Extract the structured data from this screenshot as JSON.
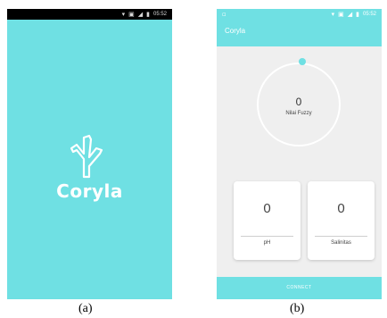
{
  "screen_a": {
    "status_time": "05:52",
    "brand": "Coryla"
  },
  "screen_b": {
    "status_time": "05:52",
    "appbar_title": "Coryla",
    "gauge": {
      "value": "0",
      "label": "Nilai Fuzzy"
    },
    "cards": [
      {
        "value": "0",
        "label": "pH"
      },
      {
        "value": "0",
        "label": "Salinitas"
      }
    ],
    "connect_label": "CONNECT"
  },
  "captions": {
    "a": "(a)",
    "b": "(b)"
  },
  "colors": {
    "accent": "#6fe0e3",
    "background_b": "#efefef",
    "statusbar_a": "#000000"
  }
}
